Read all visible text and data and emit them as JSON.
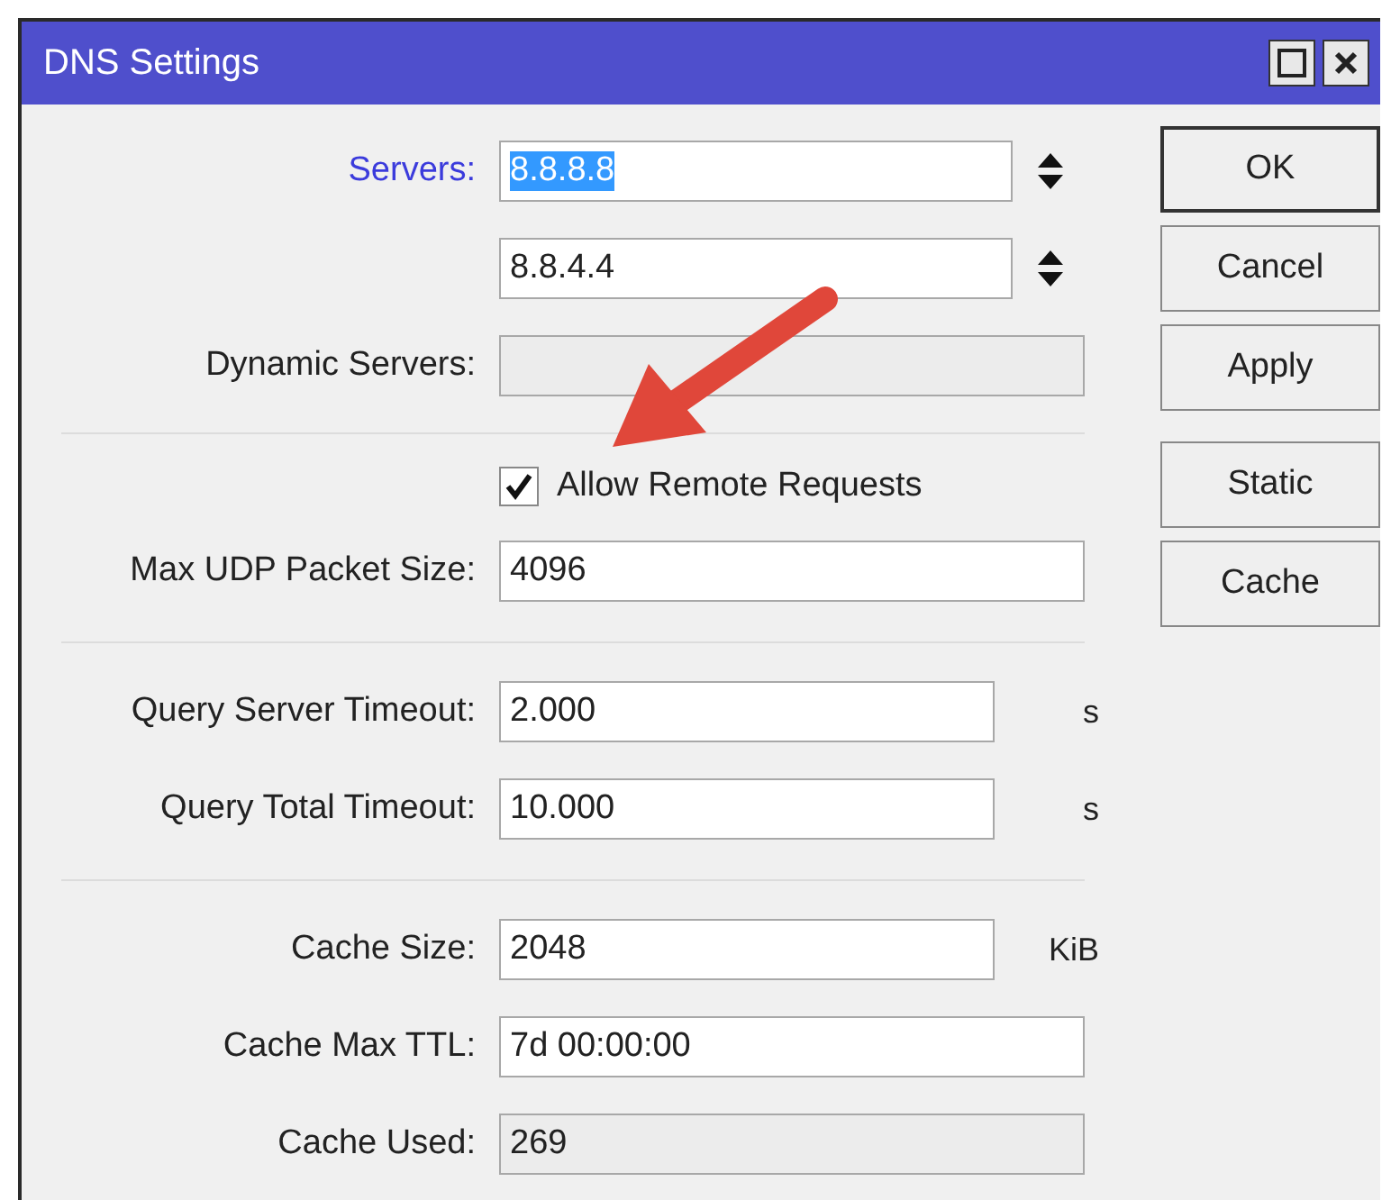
{
  "window": {
    "title": "DNS Settings"
  },
  "rows": [
    {
      "kind": "field",
      "label": "Servers:",
      "label_link": true,
      "value": "8.8.8.8",
      "value_selected": true,
      "spinner": true
    },
    {
      "kind": "field",
      "value": "8.8.4.4",
      "spinner": true
    },
    {
      "kind": "field",
      "label": "Dynamic Servers:",
      "readonly": true
    },
    {
      "kind": "divider"
    },
    {
      "kind": "checkbox",
      "label": "Allow Remote Requests",
      "checked": true
    },
    {
      "kind": "field",
      "label": "Max UDP Packet Size:",
      "value": "4096"
    },
    {
      "kind": "divider"
    },
    {
      "kind": "field",
      "label": "Query Server Timeout:",
      "value": "2.000",
      "unit": "s"
    },
    {
      "kind": "field",
      "label": "Query Total Timeout:",
      "value": "10.000",
      "unit": "s"
    },
    {
      "kind": "divider"
    },
    {
      "kind": "field",
      "label": "Cache Size:",
      "value": "2048",
      "unit": "KiB"
    },
    {
      "kind": "field",
      "label": "Cache Max TTL:",
      "value": "7d 00:00:00"
    },
    {
      "kind": "field",
      "label": "Cache Used:",
      "value": "269",
      "readonly": true
    }
  ],
  "button_groups": [
    [
      {
        "label": "OK",
        "default": true
      },
      {
        "label": "Cancel"
      },
      {
        "label": "Apply"
      }
    ],
    [
      {
        "label": "Static"
      },
      {
        "label": "Cache"
      }
    ]
  ]
}
